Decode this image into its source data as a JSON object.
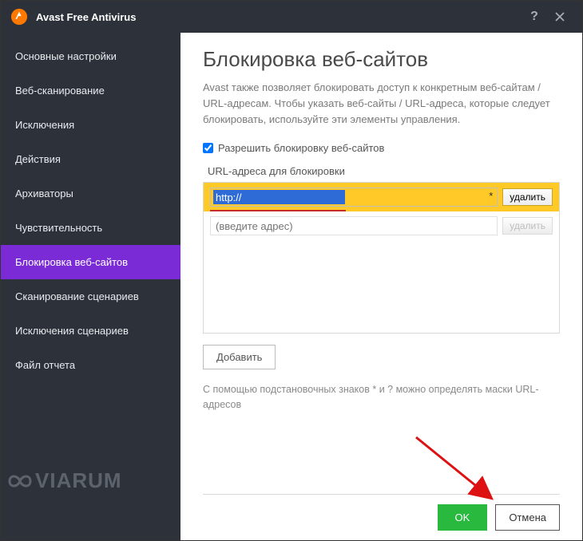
{
  "titlebar": {
    "title": "Avast Free Antivirus"
  },
  "sidebar": {
    "items": [
      {
        "label": "Основные настройки"
      },
      {
        "label": "Веб-сканирование"
      },
      {
        "label": "Исключения"
      },
      {
        "label": "Действия"
      },
      {
        "label": "Архиваторы"
      },
      {
        "label": "Чувствительность"
      },
      {
        "label": "Блокировка веб-сайтов"
      },
      {
        "label": "Сканирование сценариев"
      },
      {
        "label": "Исключения сценариев"
      },
      {
        "label": "Файл отчета"
      }
    ],
    "active_index": 6
  },
  "main": {
    "title": "Блокировка веб-сайтов",
    "description": "Avast также позволяет блокировать доступ к конкретным веб-сайтам / URL-адресам. Чтобы указать веб-сайты / URL-адреса, которые следует блокировать, используйте эти элементы управления.",
    "checkbox_label": "Разрешить блокировку веб-сайтов",
    "checkbox_checked": true,
    "section_label": "URL-адреса для блокировки",
    "rows": [
      {
        "value": "http://",
        "star": "*",
        "delete_label": "удалить"
      },
      {
        "placeholder": "(введите адрес)",
        "delete_label": "удалить"
      }
    ],
    "add_label": "Добавить",
    "hint": "С помощью подстановочных знаков * и ? можно определять маски URL-адресов"
  },
  "footer": {
    "ok": "OK",
    "cancel": "Отмена"
  },
  "watermark": "VIARUM"
}
